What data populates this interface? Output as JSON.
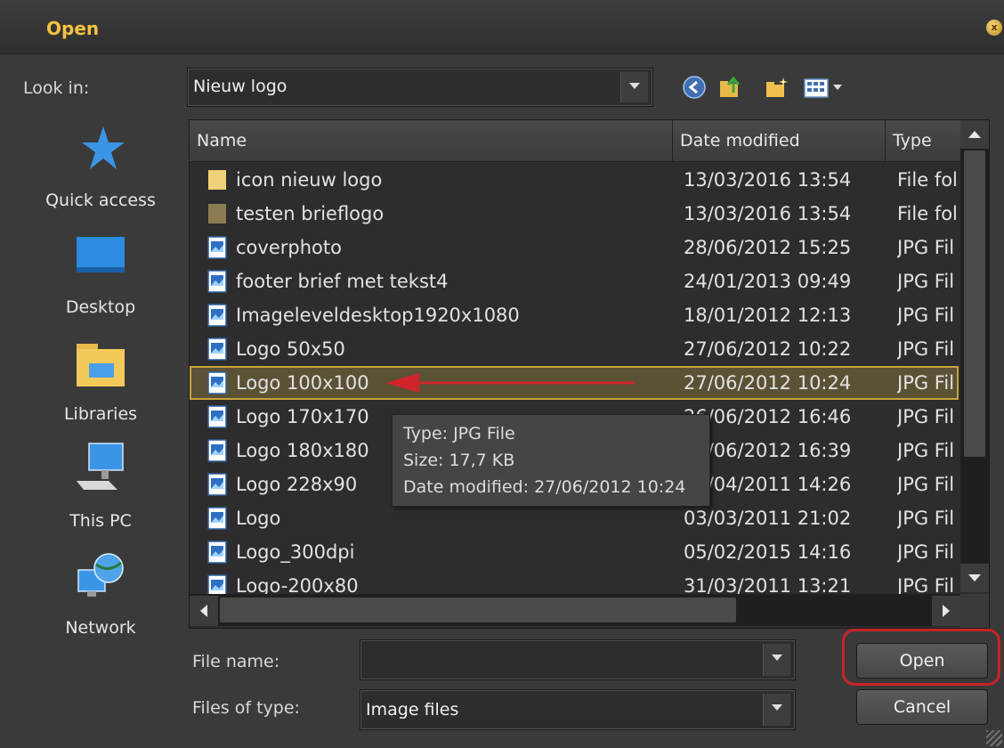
{
  "window": {
    "title": "Open",
    "close_icon": "close-icon"
  },
  "look_in": {
    "label": "Look in:",
    "value": "Nieuw logo"
  },
  "toolbar": {
    "icons": [
      "back-icon",
      "up-folder-icon",
      "new-folder-icon",
      "view-menu-icon"
    ]
  },
  "places": [
    {
      "label": "Quick access",
      "icon": "star-icon"
    },
    {
      "label": "Desktop",
      "icon": "desktop-icon"
    },
    {
      "label": "Libraries",
      "icon": "libraries-icon"
    },
    {
      "label": "This PC",
      "icon": "computer-icon"
    },
    {
      "label": "Network",
      "icon": "network-icon"
    }
  ],
  "columns": {
    "name": "Name",
    "date": "Date modified",
    "type": "Type"
  },
  "files": [
    {
      "name": "icon nieuw logo",
      "date": "13/03/2016 13:54",
      "type": "File fol",
      "icon": "folder-icon"
    },
    {
      "name": "testen brieflogo",
      "date": "13/03/2016 13:54",
      "type": "File fol",
      "icon": "folder-icon"
    },
    {
      "name": "coverphoto",
      "date": "28/06/2012 15:25",
      "type": "JPG Fil",
      "icon": "image-file-icon"
    },
    {
      "name": "footer brief met tekst4",
      "date": "24/01/2013 09:49",
      "type": "JPG Fil",
      "icon": "image-file-icon"
    },
    {
      "name": "Imageleveldesktop1920x1080",
      "date": "18/01/2012 12:13",
      "type": "JPG Fil",
      "icon": "image-file-icon"
    },
    {
      "name": "Logo 50x50",
      "date": "27/06/2012 10:22",
      "type": "JPG Fil",
      "icon": "image-file-icon"
    },
    {
      "name": "Logo 100x100",
      "date": "27/06/2012 10:24",
      "type": "JPG Fil",
      "icon": "image-file-icon",
      "selected": true
    },
    {
      "name": "Logo 170x170",
      "date": "26/06/2012 16:46",
      "type": "JPG Fil",
      "icon": "image-file-icon"
    },
    {
      "name": "Logo 180x180",
      "date": "26/06/2012 16:39",
      "type": "JPG Fil",
      "icon": "image-file-icon"
    },
    {
      "name": "Logo 228x90",
      "date": "04/04/2011 14:26",
      "type": "JPG Fil",
      "icon": "image-file-icon"
    },
    {
      "name": "Logo",
      "date": "03/03/2011 21:02",
      "type": "JPG Fil",
      "icon": "image-file-icon"
    },
    {
      "name": "Logo_300dpi",
      "date": "05/02/2015 14:16",
      "type": "JPG Fil",
      "icon": "image-file-icon"
    },
    {
      "name": "Logo-200x80",
      "date": "31/03/2011 13:21",
      "type": "JPG Fil",
      "icon": "image-file-icon"
    }
  ],
  "tooltip": {
    "type_line": "Type: JPG File",
    "size_line": "Size: 17,7 KB",
    "date_line": "Date modified: 27/06/2012 10:24"
  },
  "file_name": {
    "label": "File name:",
    "value": ""
  },
  "file_type": {
    "label": "Files of type:",
    "value": "Image files"
  },
  "buttons": {
    "open": "Open",
    "cancel": "Cancel"
  },
  "colors": {
    "title_accent": "#f5c242",
    "selection": "#c9a23a",
    "annotation_red": "#d0242c"
  }
}
